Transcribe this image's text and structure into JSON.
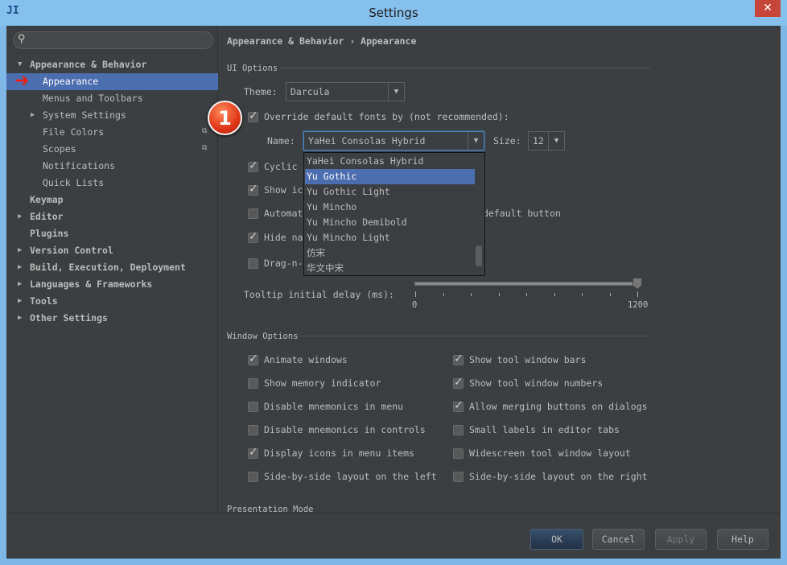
{
  "window": {
    "title": "Settings",
    "app_icon": "intellij-icon",
    "close_label": "✕"
  },
  "sidebar": {
    "items": [
      {
        "label": "Appearance & Behavior",
        "expanded": true
      },
      {
        "label": "Appearance",
        "selected": true
      },
      {
        "label": "Menus and Toolbars"
      },
      {
        "label": "System Settings"
      },
      {
        "label": "File Colors"
      },
      {
        "label": "Scopes"
      },
      {
        "label": "Notifications"
      },
      {
        "label": "Quick Lists"
      },
      {
        "label": "Keymap"
      },
      {
        "label": "Editor"
      },
      {
        "label": "Plugins"
      },
      {
        "label": "Version Control"
      },
      {
        "label": "Build, Execution, Deployment"
      },
      {
        "label": "Languages & Frameworks"
      },
      {
        "label": "Tools"
      },
      {
        "label": "Other Settings"
      }
    ]
  },
  "breadcrumb": "Appearance & Behavior › Appearance",
  "ui_options": {
    "title": "UI Options",
    "theme_label": "Theme:",
    "theme_value": "Darcula",
    "override_label": "Override default fonts by (not recommended):",
    "override_checked": true,
    "name_label": "Name:",
    "name_value": "YaHei Consolas Hybrid",
    "size_label": "Size:",
    "size_value": "12",
    "options": [
      {
        "label": "Cyclic",
        "checked": true
      },
      {
        "label": "Show ic",
        "checked": true
      },
      {
        "label": "Automat",
        "suffix": "default button",
        "checked": false
      },
      {
        "label": "Hide na",
        "checked": true
      },
      {
        "label": "Drag-n-",
        "checked": false
      }
    ],
    "tooltip_label": "Tooltip initial delay (ms):",
    "tooltip_min": "0",
    "tooltip_max": "1200",
    "tooltip_value": 1200
  },
  "font_dropdown": {
    "items": [
      "YaHei Consolas Hybrid",
      "Yu Gothic",
      "Yu Gothic Light",
      "Yu Mincho",
      "Yu Mincho Demibold",
      "Yu Mincho Light",
      "仿宋",
      "华文中宋"
    ],
    "selected": "Yu Gothic"
  },
  "window_options": {
    "title": "Window Options",
    "left": [
      {
        "label": "Animate windows",
        "checked": true
      },
      {
        "label": "Show memory indicator",
        "checked": false
      },
      {
        "label": "Disable mnemonics in menu",
        "checked": false
      },
      {
        "label": "Disable mnemonics in controls",
        "checked": false
      },
      {
        "label": "Display icons in menu items",
        "checked": true
      },
      {
        "label": "Side-by-side layout on the left",
        "checked": false
      }
    ],
    "right": [
      {
        "label": "Show tool window bars",
        "checked": true
      },
      {
        "label": "Show tool window numbers",
        "checked": true
      },
      {
        "label": "Allow merging buttons on dialogs",
        "checked": true
      },
      {
        "label": "Small labels in editor tabs",
        "checked": false
      },
      {
        "label": "Widescreen tool window layout",
        "checked": false
      },
      {
        "label": "Side-by-side layout on the right",
        "checked": false
      }
    ]
  },
  "presentation_title": "Presentation Mode",
  "annotation": {
    "badge": "1"
  },
  "buttons": {
    "ok": "OK",
    "cancel": "Cancel",
    "apply": "Apply",
    "help": "Help"
  },
  "colors": {
    "selection": "#4b6eaf",
    "background": "#3c3f41",
    "titlebar": "#86c0ec"
  }
}
